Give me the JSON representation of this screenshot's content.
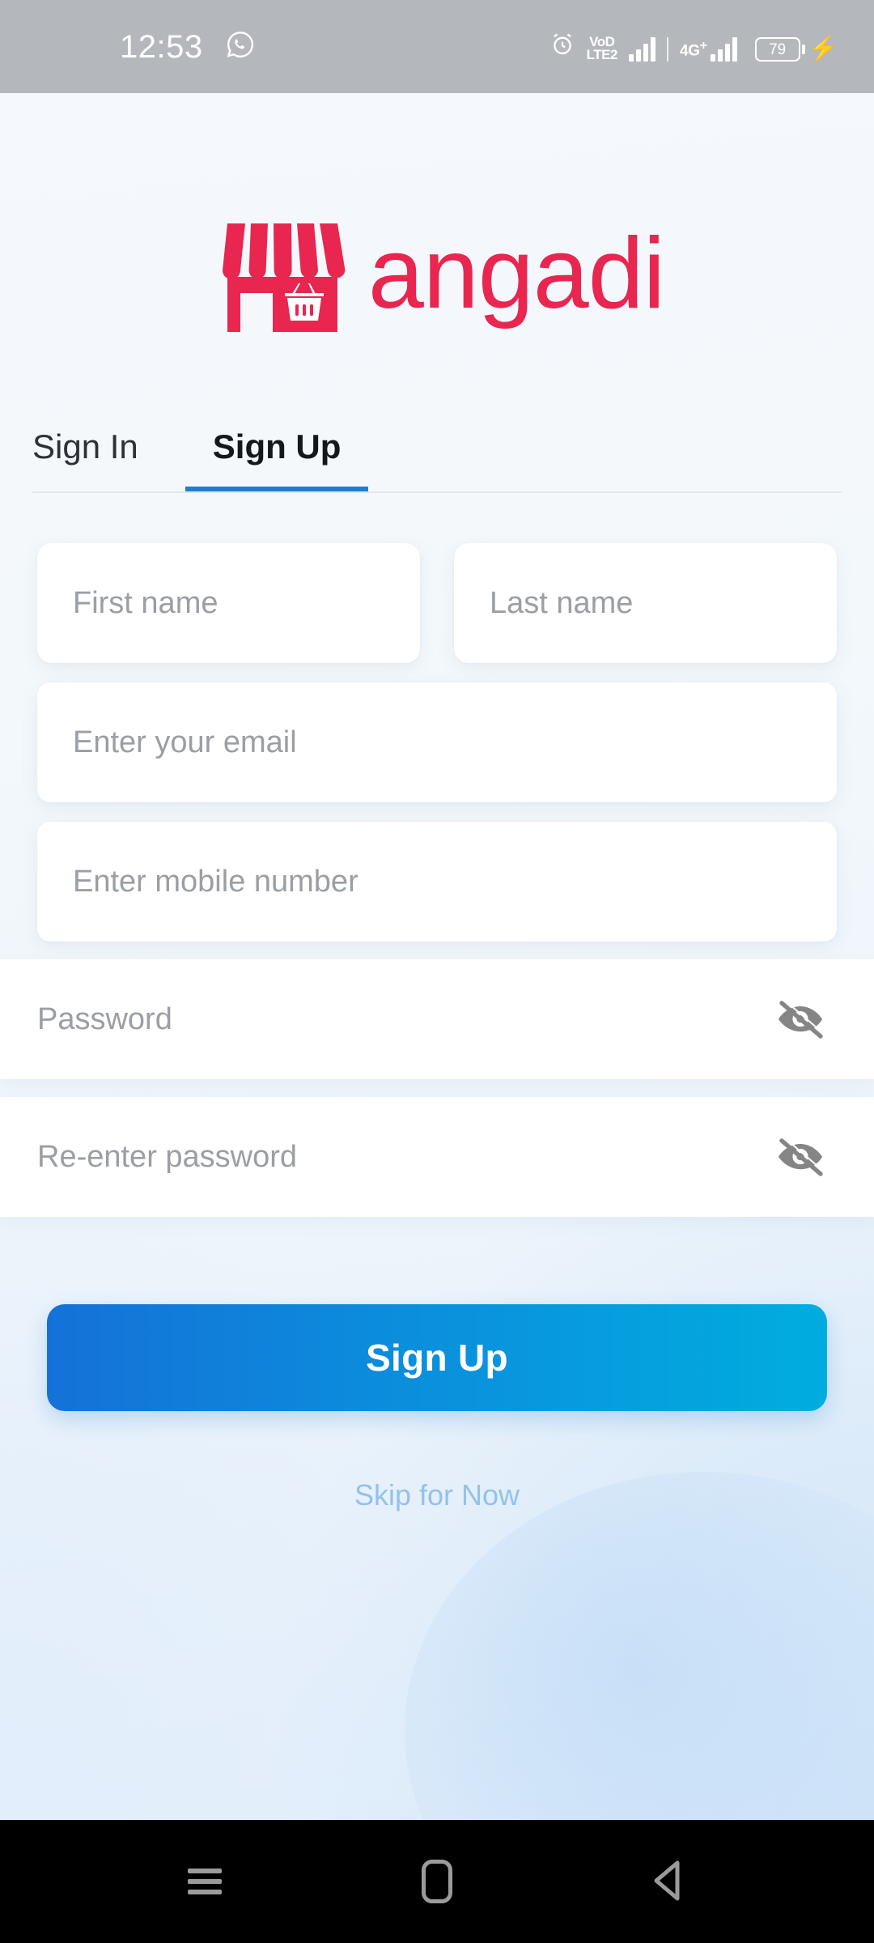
{
  "status_bar": {
    "time": "12:53",
    "whatsapp_icon": "whatsapp-icon",
    "alarm_icon": "alarm-clock-icon",
    "volte_line1": "VoD",
    "volte_line2": "LTE2",
    "network_label": "4G",
    "network_plus": "+",
    "battery_percent": "79",
    "charging_icon": "charging-bolt-icon"
  },
  "brand": {
    "wordmark": "angadi",
    "logo_icon": "storefront-icon",
    "color": "#E8264F"
  },
  "tabs": {
    "sign_in": "Sign In",
    "sign_up": "Sign Up",
    "active": "Sign Up",
    "indicator_color": "#1C7FD4"
  },
  "form": {
    "first_name": {
      "placeholder": "First name",
      "value": ""
    },
    "last_name": {
      "placeholder": "Last name",
      "value": ""
    },
    "email": {
      "placeholder": "Enter your email",
      "value": ""
    },
    "mobile": {
      "placeholder": "Enter mobile number",
      "value": ""
    },
    "password": {
      "placeholder": "Password",
      "value": "",
      "toggle_icon": "eye-off-icon"
    },
    "confirm_password": {
      "placeholder": "Re-enter password",
      "value": "",
      "toggle_icon": "eye-off-icon"
    }
  },
  "actions": {
    "submit_label": "Sign Up",
    "submit_gradient_from": "#1571D8",
    "submit_gradient_to": "#00ADDF",
    "skip_label": "Skip for Now",
    "skip_color": "#93C2EA"
  },
  "nav_bar": {
    "recents": "recents-menu-icon",
    "home": "home-icon",
    "back": "back-icon"
  }
}
